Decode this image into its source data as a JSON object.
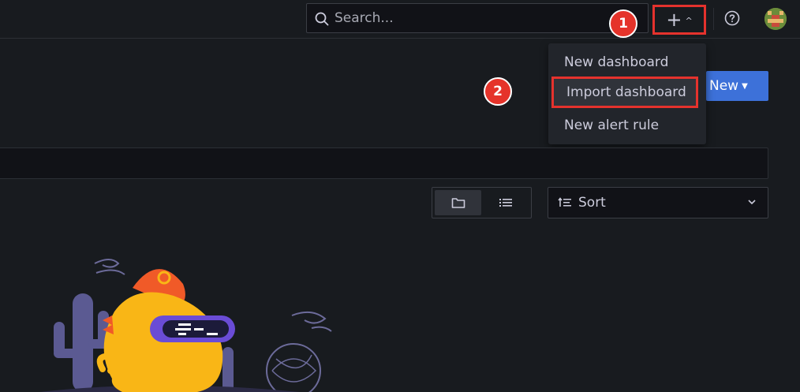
{
  "topbar": {
    "search_placeholder": "Search...",
    "add_menu_icon": "plus-icon",
    "add_menu_caret": "chevron-up-icon",
    "help_icon": "help-circle-icon"
  },
  "add_menu": {
    "items": [
      {
        "label": "New dashboard"
      },
      {
        "label": "Import dashboard"
      },
      {
        "label": "New alert rule"
      }
    ]
  },
  "annotations": {
    "step1": "1",
    "step2": "2"
  },
  "page": {
    "new_button_label": "New",
    "sort_label": "Sort",
    "view_toggle": {
      "folder_view": "folder-icon",
      "list_view": "list-icon"
    }
  },
  "colors": {
    "background": "#181b1f",
    "accent": "#3d71d9",
    "highlight_border": "#e5322d",
    "badge": "#e5332a",
    "mascot": "#f9b616"
  }
}
